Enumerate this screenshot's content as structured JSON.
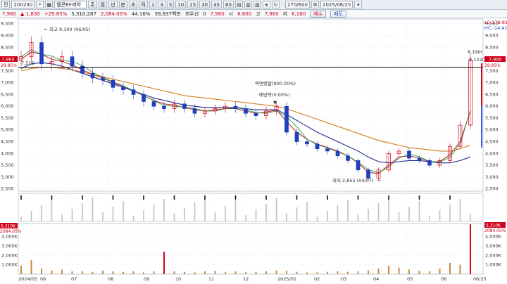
{
  "toolbar": {
    "mode": "전",
    "code": "200230",
    "stock_name": "텔콘RF제약",
    "periods": [
      "주",
      "월",
      "년",
      "분",
      "초",
      "틱"
    ],
    "numbers": [
      "1",
      "3",
      "5",
      "10",
      "15",
      "30",
      "45",
      "60"
    ],
    "count": "270/600",
    "date": "2025/06/25"
  },
  "info": {
    "price": "7,960",
    "change": "1,830",
    "change_pct": "+29.85%",
    "volume": "5,310,287",
    "volume_ratio": "2,084.05%",
    "turnover": "44.16%",
    "amount": "39,937백만",
    "rotation_label": "회우선",
    "rotation_value": "0",
    "close": "7,960",
    "open_label": "시",
    "open": "6,600",
    "high_label": "고",
    "high": "7,960",
    "low_label": "저",
    "low": "6,160",
    "buy_label": "매수",
    "sell_label": "매도"
  },
  "chart": {
    "right_labels": {
      "lc": "LC:178.81",
      "hc": "HC:-14.41",
      "price_tag": "7,960",
      "price_pct": "29.85%",
      "volume_tag": "5,310K",
      "volume_pct": "2084.05%"
    },
    "left_labels": {
      "price_tag": "7,960",
      "price_pct": "29.85%",
      "level_label": "7,515",
      "volume_tag": "5,310K",
      "volume_pct": "2084.05%"
    },
    "annotations": {
      "high": "최고 9,300 (06/05)",
      "low": "최저 2,855 (04/07)",
      "reverse_split": "액면병합(900.00%)",
      "ex_dividend": "배당락(0.00%)",
      "top_8190": "8,190(",
      "top_8122": "8,122("
    },
    "colors": {
      "up": "#d0021b",
      "down": "#1f3fbf",
      "ma5": "#2e9e4a",
      "ma20": "#c0262f",
      "ma60": "#1c2a8c",
      "ma120": "#d97a1b"
    }
  },
  "chart_data": {
    "type": "line",
    "y_ticks": [
      "9,500",
      "9,000",
      "8,500",
      "8,000",
      "7,500",
      "7,000",
      "6,500",
      "6,000",
      "5,500",
      "5,000",
      "4,500",
      "4,000",
      "3,500",
      "3,000",
      "2,500"
    ],
    "x_ticks": [
      "2024/05",
      "06",
      "07",
      "08",
      "09",
      "10",
      "11",
      "12",
      "2025/01",
      "02",
      "03",
      "04",
      "05",
      "06",
      "06/25"
    ],
    "vol_ticks": [
      "4,000K",
      "3,000K",
      "2,000K",
      "1,000K"
    ],
    "ylim": [
      2400,
      9700
    ],
    "series": [
      {
        "name": "close",
        "values": [
          8100,
          8700,
          7800,
          7900,
          8100,
          7700,
          7400,
          7200,
          7100,
          6800,
          6700,
          6500,
          6200,
          6000,
          5900,
          6100,
          5900,
          5700,
          5800,
          5900,
          6000,
          5900,
          5700,
          5600,
          5800,
          6000,
          4900,
          4500,
          4400,
          4200,
          4100,
          3900,
          3700,
          3300,
          2950,
          3300,
          4000,
          4100,
          3800,
          3700,
          3500,
          3700,
          4300,
          5200,
          7960
        ]
      },
      {
        "name": "ma20",
        "values": [
          8000,
          8300,
          8200,
          8000,
          7900,
          7750,
          7550,
          7350,
          7200,
          7000,
          6850,
          6650,
          6450,
          6250,
          6100,
          6050,
          5950,
          5850,
          5800,
          5850,
          5900,
          5900,
          5800,
          5700,
          5750,
          5850,
          5350,
          4900,
          4600,
          4400,
          4250,
          4100,
          3900,
          3600,
          3200,
          3150,
          3500,
          3850,
          3900,
          3800,
          3650,
          3650,
          3950,
          4500,
          5800
        ]
      },
      {
        "name": "ma60",
        "values": [
          7600,
          7800,
          7850,
          7800,
          7700,
          7550,
          7400,
          7250,
          7100,
          6950,
          6800,
          6650,
          6500,
          6350,
          6250,
          6150,
          6050,
          6000,
          5950,
          5950,
          5950,
          5950,
          5900,
          5850,
          5850,
          5850,
          5650,
          5400,
          5150,
          4900,
          4700,
          4500,
          4300,
          4100,
          3850,
          3650,
          3600,
          3650,
          3700,
          3700,
          3650,
          3600,
          3600,
          3700,
          3850
        ]
      },
      {
        "name": "ma120",
        "values": [
          7500,
          7600,
          7650,
          7650,
          7600,
          7550,
          7450,
          7350,
          7250,
          7150,
          7050,
          6950,
          6850,
          6750,
          6650,
          6550,
          6450,
          6400,
          6350,
          6300,
          6250,
          6200,
          6150,
          6100,
          6050,
          6000,
          5900,
          5750,
          5600,
          5450,
          5300,
          5150,
          5000,
          4850,
          4700,
          4550,
          4450,
          4350,
          4250,
          4200,
          4150,
          4100,
          4100,
          4200,
          4350
        ]
      }
    ],
    "volume": [
      900,
      1500,
      600,
      400,
      500,
      300,
      300,
      250,
      400,
      300,
      250,
      300,
      200,
      300,
      2400,
      300,
      250,
      200,
      300,
      350,
      250,
      300,
      200,
      250,
      300,
      400,
      350,
      250,
      200,
      200,
      250,
      300,
      250,
      300,
      400,
      600,
      900,
      700,
      500,
      350,
      300,
      600,
      1200,
      1000,
      5310
    ]
  }
}
